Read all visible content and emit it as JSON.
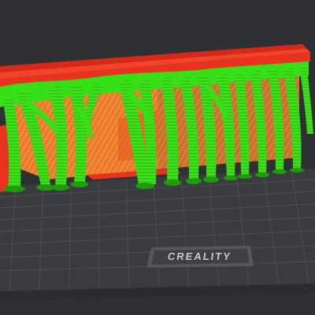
{
  "viewer": {
    "brand_label": "CREALITY",
    "scene": "sliced-model-with-tree-supports"
  },
  "colors": {
    "background": "#2f3033",
    "bed_grid": "#4a4c50",
    "bed_surface": "#3a3b3e",
    "model_red": "#e8321f",
    "model_orange": "#ee8a3a",
    "support_green": "#35e016",
    "support_green_dark": "#1f9b0c"
  },
  "icons": {
    "brand": "creality-logo-plate"
  }
}
